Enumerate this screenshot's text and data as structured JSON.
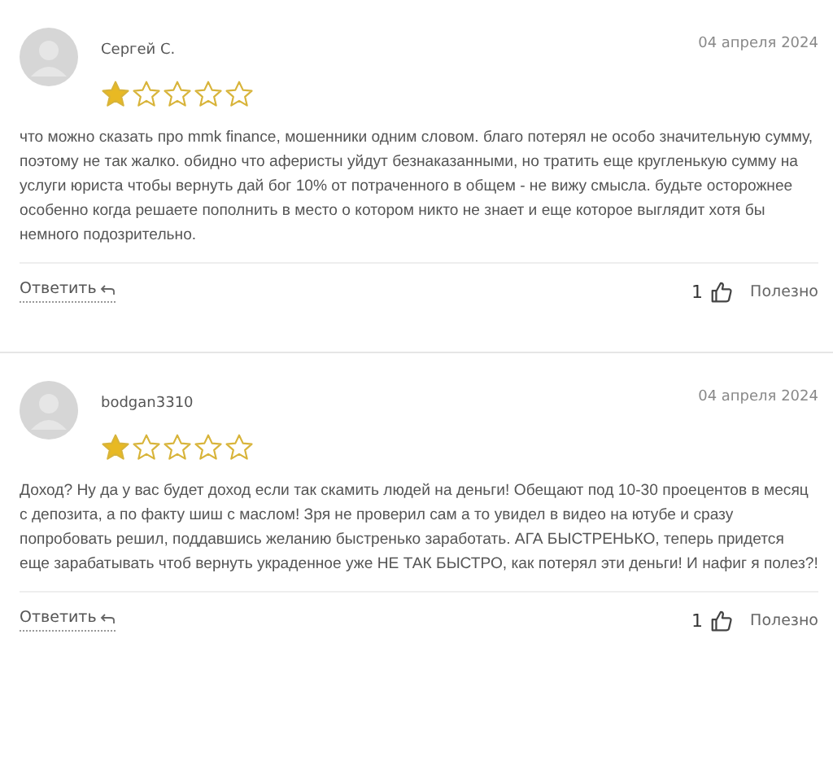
{
  "reviews": [
    {
      "author": "Сергей С.",
      "date": "04 апреля 2024",
      "stars": 1,
      "text": "что можно сказать про mmk finance, мошенники одним словом. благо потерял не особо значительную сумму, поэтому не так жалко. обидно что аферисты уйдут безнаказанными, но тратить еще кругленькую сумму на услуги юриста чтобы вернуть дай бог 10% от потраченного в общем - не вижу смысла. будьте осторожнее особенно когда решаете пополнить в место о котором никто не знает и еще которое выглядит хотя бы немного подозрительно.",
      "reply": "Ответить",
      "likes": "1",
      "helpful": "Полезно"
    },
    {
      "author": "bodgan3310",
      "date": "04 апреля 2024",
      "stars": 1,
      "text": "Доход? Ну да у вас будет доход если так скамить людей на деньги! Обещают под 10-30 проецентов в месяц с депозита, а по факту шиш с маслом! Зря не проверил сам а то увидел в видео на ютубе и сразу попробовать решил, поддавшись желанию быстренько заработать. АГА БЫСТРЕНЬКО, теперь придется еще зарабатывать чтоб вернуть украденное уже НЕ ТАК БЫСТРО, как потерял эти деньги! И нафиг я полез?!",
      "reply": "Ответить",
      "likes": "1",
      "helpful": "Полезно"
    }
  ]
}
